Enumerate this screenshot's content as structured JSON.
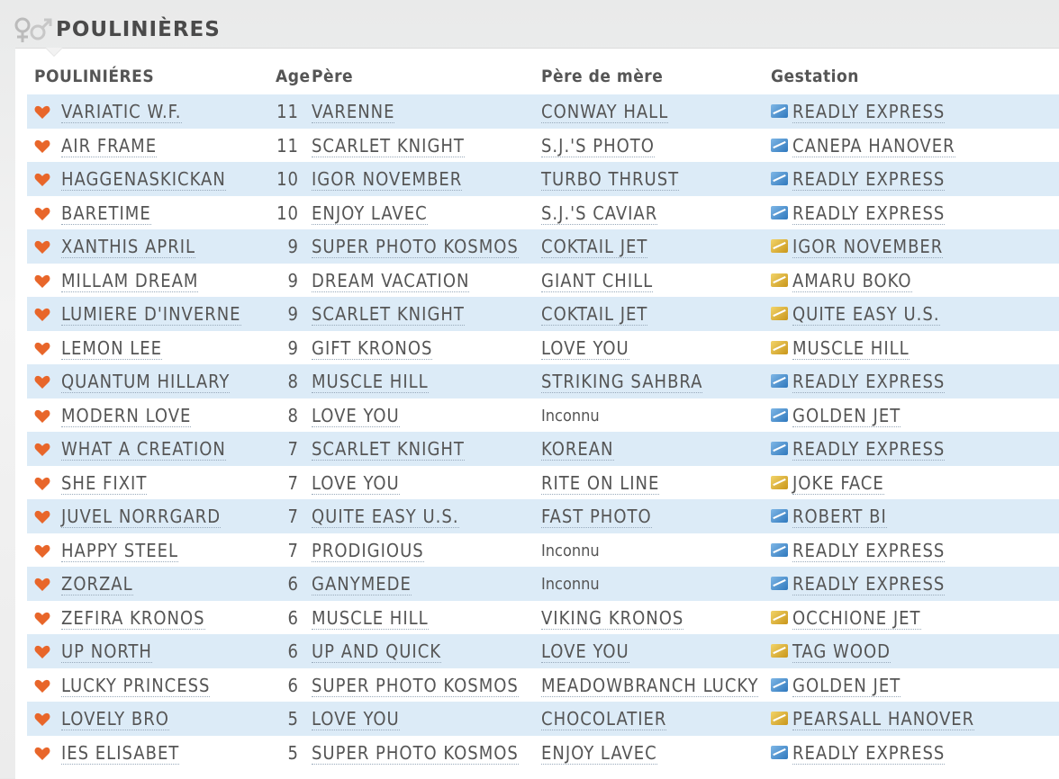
{
  "section": {
    "title": "POULINIÈRES"
  },
  "table": {
    "headers": {
      "name": "POULINIÉRES",
      "age": "Age",
      "sire": "Père",
      "dam_sire": "Père de mère",
      "gestation": "Gestation"
    },
    "rows": [
      {
        "name": "VARIATIC W.F.",
        "age": "11",
        "sire": "VARENNE",
        "dam_sire": "CONWAY HALL",
        "gestation": "READLY EXPRESS",
        "gestation_icon": "blue"
      },
      {
        "name": "AIR FRAME",
        "age": "11",
        "sire": "SCARLET KNIGHT",
        "dam_sire": "S.J.'S PHOTO",
        "gestation": "CANEPA HANOVER",
        "gestation_icon": "blue"
      },
      {
        "name": "HAGGENASKICKAN",
        "age": "10",
        "sire": "IGOR NOVEMBER",
        "dam_sire": "TURBO THRUST",
        "gestation": "READLY EXPRESS",
        "gestation_icon": "blue"
      },
      {
        "name": "BARETIME",
        "age": "10",
        "sire": "ENJOY LAVEC",
        "dam_sire": "S.J.'S CAVIAR",
        "gestation": "READLY EXPRESS",
        "gestation_icon": "blue"
      },
      {
        "name": "XANTHIS APRIL",
        "age": "9",
        "sire": "SUPER PHOTO KOSMOS",
        "dam_sire": "COKTAIL JET",
        "gestation": "IGOR NOVEMBER",
        "gestation_icon": "gold"
      },
      {
        "name": "MILLAM DREAM",
        "age": "9",
        "sire": "DREAM VACATION",
        "dam_sire": "GIANT CHILL",
        "gestation": "AMARU BOKO",
        "gestation_icon": "gold"
      },
      {
        "name": "LUMIERE D'INVERNE",
        "age": "9",
        "sire": "SCARLET KNIGHT",
        "dam_sire": "COKTAIL JET",
        "gestation": "QUITE EASY U.S.",
        "gestation_icon": "gold"
      },
      {
        "name": "LEMON LEE",
        "age": "9",
        "sire": "GIFT KRONOS",
        "dam_sire": "LOVE YOU",
        "gestation": "MUSCLE HILL",
        "gestation_icon": "gold"
      },
      {
        "name": "QUANTUM HILLARY",
        "age": "8",
        "sire": "MUSCLE HILL",
        "dam_sire": "STRIKING SAHBRA",
        "gestation": "READLY EXPRESS",
        "gestation_icon": "blue"
      },
      {
        "name": "MODERN LOVE",
        "age": "8",
        "sire": "LOVE YOU",
        "dam_sire": "Inconnu",
        "gestation": "GOLDEN JET",
        "gestation_icon": "blue"
      },
      {
        "name": "WHAT A CREATION",
        "age": "7",
        "sire": "SCARLET KNIGHT",
        "dam_sire": "KOREAN",
        "gestation": "READLY EXPRESS",
        "gestation_icon": "blue"
      },
      {
        "name": "SHE FIXIT",
        "age": "7",
        "sire": "LOVE YOU",
        "dam_sire": "RITE ON LINE",
        "gestation": "JOKE FACE",
        "gestation_icon": "gold"
      },
      {
        "name": "JUVEL NORRGARD",
        "age": "7",
        "sire": "QUITE EASY U.S.",
        "dam_sire": "FAST PHOTO",
        "gestation": "ROBERT BI",
        "gestation_icon": "blue"
      },
      {
        "name": "HAPPY STEEL",
        "age": "7",
        "sire": "PRODIGIOUS",
        "dam_sire": "Inconnu",
        "gestation": "READLY EXPRESS",
        "gestation_icon": "blue"
      },
      {
        "name": "ZORZAL",
        "age": "6",
        "sire": "GANYMEDE",
        "dam_sire": "Inconnu",
        "gestation": "READLY EXPRESS",
        "gestation_icon": "blue"
      },
      {
        "name": "ZEFIRA KRONOS",
        "age": "6",
        "sire": "MUSCLE HILL",
        "dam_sire": "VIKING KRONOS",
        "gestation": "OCCHIONE JET",
        "gestation_icon": "gold"
      },
      {
        "name": "UP NORTH",
        "age": "6",
        "sire": "UP AND QUICK",
        "dam_sire": "LOVE YOU",
        "gestation": "TAG WOOD",
        "gestation_icon": "gold"
      },
      {
        "name": "LUCKY PRINCESS",
        "age": "6",
        "sire": "SUPER PHOTO KOSMOS",
        "dam_sire": "MEADOWBRANCH LUCKY",
        "gestation": "GOLDEN JET",
        "gestation_icon": "blue"
      },
      {
        "name": "LOVELY BRO",
        "age": "5",
        "sire": "LOVE YOU",
        "dam_sire": "CHOCOLATIER",
        "gestation": "PEARSALL HANOVER",
        "gestation_icon": "gold"
      },
      {
        "name": "IES ELISABET",
        "age": "5",
        "sire": "SUPER PHOTO KOSMOS",
        "dam_sire": "ENJOY LAVEC",
        "gestation": "READLY EXPRESS",
        "gestation_icon": "blue"
      }
    ]
  },
  "colors": {
    "heart": "#e8662a",
    "row_stripe": "#dcebf7",
    "gestation_blue": "#3a82c4",
    "gestation_gold": "#d9a825"
  }
}
